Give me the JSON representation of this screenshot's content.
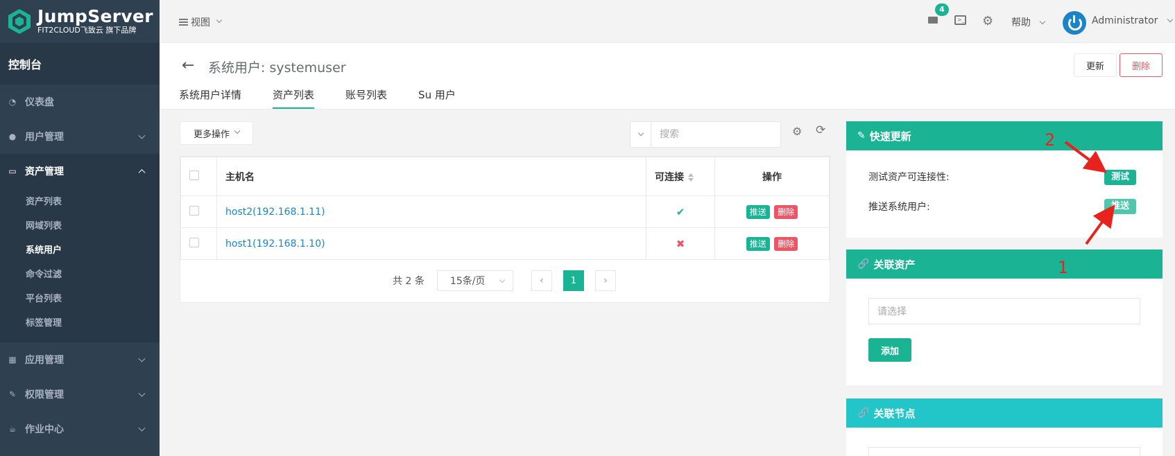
{
  "brand": {
    "name": "JumpServer",
    "tagline": "FIT2CLOUD飞致云 旗下品牌"
  },
  "sidebar": {
    "console": "控制台",
    "items": [
      {
        "label": "仪表盘",
        "icon": "dashboard-icon"
      },
      {
        "label": "用户管理",
        "icon": "users-icon"
      },
      {
        "label": "资产管理",
        "icon": "inbox-icon"
      },
      {
        "label": "应用管理",
        "icon": "grid-icon"
      },
      {
        "label": "权限管理",
        "icon": "edit-icon"
      },
      {
        "label": "作业中心",
        "icon": "coffee-icon"
      }
    ],
    "asset_sub": [
      "资产列表",
      "网域列表",
      "系统用户",
      "命令过滤",
      "平台列表",
      "标签管理"
    ],
    "active_sub": "系统用户"
  },
  "topbar": {
    "view_label": "视图",
    "mail_count": "4",
    "help_label": "帮助",
    "user_name": "Administrator"
  },
  "page": {
    "title": "系统用户: systemuser",
    "update_label": "更新",
    "delete_label": "删除",
    "tabs": [
      "系统用户详情",
      "资产列表",
      "账号列表",
      "Su 用户"
    ],
    "active_tab": "资产列表"
  },
  "table": {
    "more_actions": "更多操作",
    "search_placeholder": "搜索",
    "columns": {
      "hostname": "主机名",
      "connectable": "可连接",
      "actions": "操作"
    },
    "rows": [
      {
        "hostname": "host2(192.168.1.11)",
        "connectable": "✔",
        "push": "推送",
        "delete": "删除"
      },
      {
        "hostname": "host1(192.168.1.10)",
        "connectable": "✖",
        "push": "推送",
        "delete": "删除"
      }
    ],
    "pagination": {
      "total": "共 2 条",
      "page_size": "15条/页",
      "current_page": "1"
    }
  },
  "quick_update": {
    "title": "快速更新",
    "test_label": "测试资产可连接性:",
    "test_button": "测试",
    "push_label": "推送系统用户:",
    "push_button": "推送"
  },
  "related_assets": {
    "title": "关联资产",
    "placeholder": "请选择",
    "add_button": "添加"
  },
  "related_nodes": {
    "title": "关联节点"
  },
  "annotations": {
    "one": "1",
    "two": "2"
  },
  "colors": {
    "primary": "#1ab394",
    "danger": "#ed5565",
    "info": "#23c6c8",
    "sidebar": "#2f4050",
    "annotation": "#e8231e"
  }
}
